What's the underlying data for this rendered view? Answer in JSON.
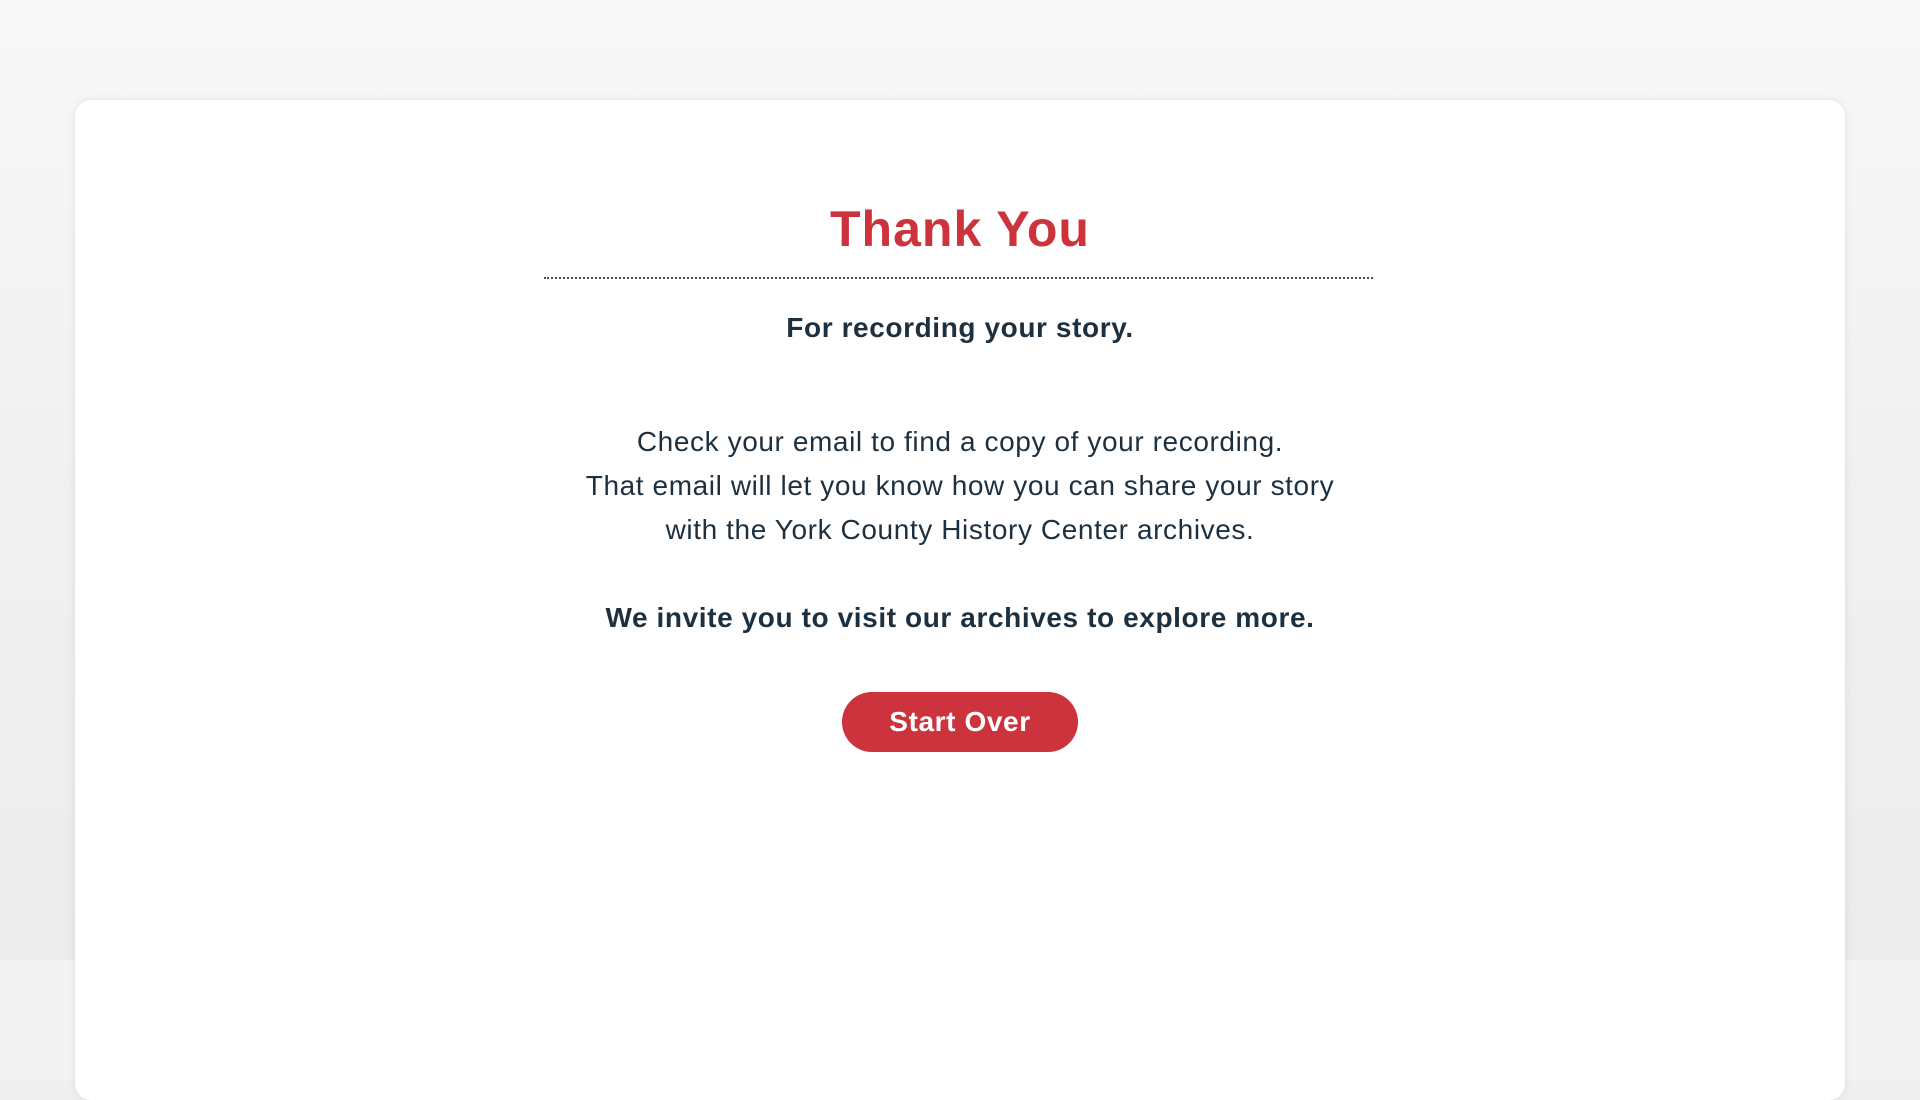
{
  "theme": {
    "accent_color": "#cc333d",
    "text_color": "#1c3040"
  },
  "thank_you": {
    "title": "Thank You",
    "subtitle": "For recording your story.",
    "body_lines": [
      "Check your email to find a copy of your recording.",
      "That email will let you know how you can share your story",
      "with the York County History Center archives."
    ],
    "invite": "We invite you to visit our archives to explore more.",
    "start_over_label": "Start Over"
  }
}
